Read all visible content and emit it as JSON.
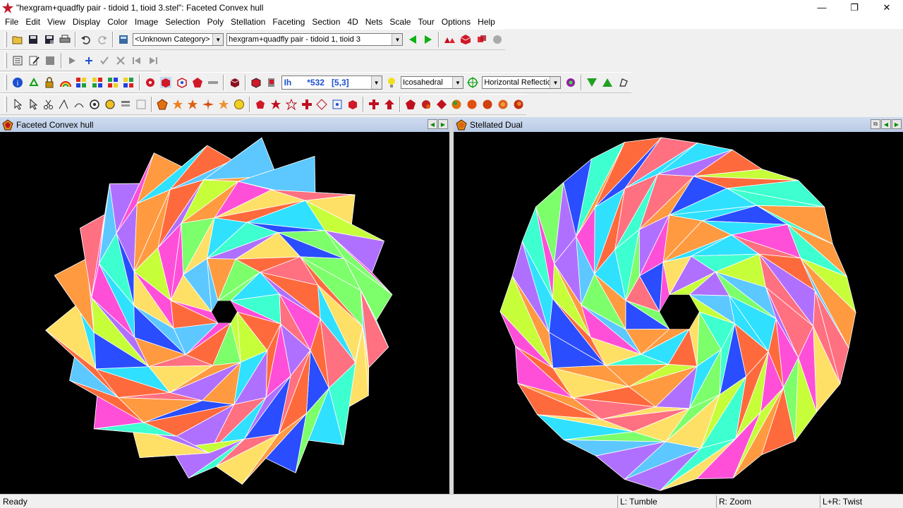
{
  "window": {
    "title": "\"hexgram+quadfly pair - tidoid 1, tioid 3.stel\": Faceted Convex hull",
    "minimize": "—",
    "maximize": "❐",
    "close": "✕"
  },
  "menu": [
    "File",
    "Edit",
    "View",
    "Display",
    "Color",
    "Image",
    "Selection",
    "Poly",
    "Stellation",
    "Faceting",
    "Section",
    "4D",
    "Nets",
    "Scale",
    "Tour",
    "Options",
    "Help"
  ],
  "toolbar1": {
    "category": "<Unknown Category>",
    "model": "hexgram+quadfly pair - tidoid 1, tioid 3"
  },
  "toolbar3": {
    "symmetry": "Ih",
    "symmetry_code": "*532",
    "symmetry_bracket": "[5,3]",
    "group": "Icosahedral",
    "reflection": "Horizontal Reflection"
  },
  "left_pane": {
    "title": "Faceted Convex hull"
  },
  "right_pane": {
    "title": "Stellated Dual"
  },
  "status": {
    "ready": "Ready",
    "left": "L: Tumble",
    "right": "R: Zoom",
    "both": "L+R: Twist"
  },
  "colors": {
    "accent_blue": "#1a4fd0",
    "header_blue": "#c3d3eb",
    "palette": [
      "#ff4fd8",
      "#7cff6b",
      "#5cc8ff",
      "#ffe066",
      "#b070ff",
      "#ff6a3d",
      "#3dffd0",
      "#2a4dff",
      "#ff9a40",
      "#c6ff3a",
      "#ff7080",
      "#30e0ff"
    ]
  }
}
